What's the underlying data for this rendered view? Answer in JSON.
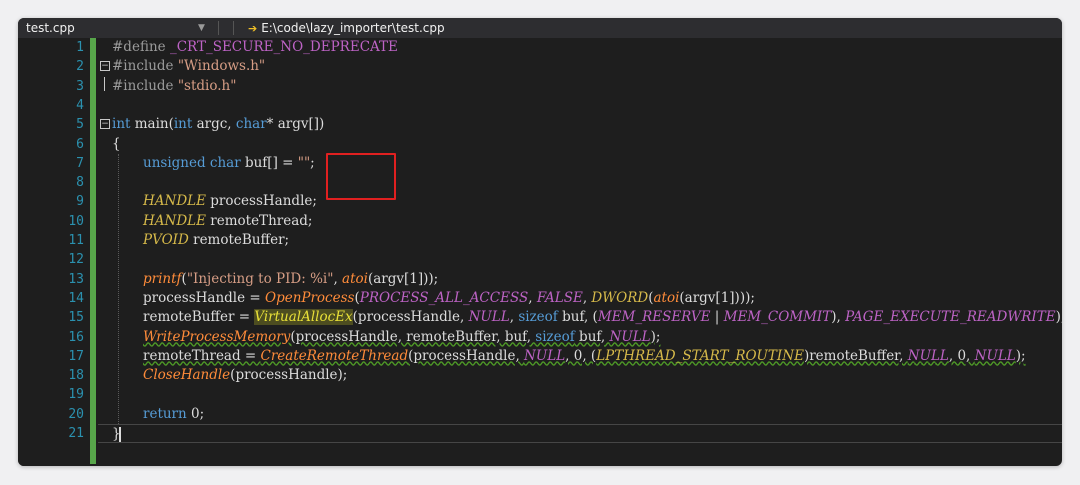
{
  "tab": {
    "filename": "test.cpp",
    "path": "E:\\code\\lazy_importer\\test.cpp",
    "dropdown_icon": "chevron-down-icon",
    "nav_icon": "arrow-right-icon"
  },
  "colors": {
    "keyword": "#569cd6",
    "preprocessor": "#9b9b9b",
    "macro": "#bd63c5",
    "string": "#d69d85",
    "type": "#d7ba4a",
    "function": "#dcdcaa",
    "line_number": "#2b91af",
    "change_bar": "#57a64a",
    "highlight_box": "#e02020"
  },
  "line_numbers": [
    "1",
    "2",
    "3",
    "4",
    "5",
    "6",
    "7",
    "8",
    "9",
    "10",
    "11",
    "12",
    "13",
    "14",
    "15",
    "16",
    "17",
    "18",
    "19",
    "20",
    "21"
  ],
  "code": {
    "l1": [
      "#define ",
      "_CRT_SECURE_NO_DEPRECATE"
    ],
    "l2": [
      "#include ",
      "\"Windows.h\""
    ],
    "l3": [
      "#include ",
      "\"stdio.h\""
    ],
    "l5": [
      "int",
      " main(",
      "int",
      " argc, ",
      "char",
      "* argv[])"
    ],
    "l6": [
      "{"
    ],
    "l7": [
      "unsigned",
      " ",
      "char",
      " buf[] = ",
      "\"\"",
      ";"
    ],
    "l9": [
      "HANDLE",
      " processHandle;"
    ],
    "l10": [
      "HANDLE",
      " remoteThread;"
    ],
    "l11": [
      "PVOID",
      " remoteBuffer;"
    ],
    "l13": [
      "printf",
      "(",
      "\"Injecting to PID: %i\"",
      ", ",
      "atoi",
      "(argv[1]));"
    ],
    "l14": [
      "processHandle = ",
      "OpenProcess",
      "(",
      "PROCESS_ALL_ACCESS",
      ", ",
      "FALSE",
      ", ",
      "DWORD",
      "(",
      "atoi",
      "(argv[1])));"
    ],
    "l15": [
      "remoteBuffer = ",
      "VirtualAllocEx",
      "(processHandle, ",
      "NULL",
      ", ",
      "sizeof",
      " buf, (",
      "MEM_RESERVE",
      " | ",
      "MEM_COMMIT",
      "), ",
      "PAGE_EXECUTE_READWRITE",
      ");"
    ],
    "l16": [
      "WriteProcessMemory",
      "(processHandle, remoteBuffer, buf, ",
      "sizeof",
      " buf, ",
      "NULL",
      ");"
    ],
    "l17": [
      "remoteThread = ",
      "CreateRemoteThread",
      "(processHandle, ",
      "NULL",
      ", 0, (",
      "LPTHREAD_START_ROUTINE",
      ")remoteBuffer, ",
      "NULL",
      ", 0, ",
      "NULL",
      ");"
    ],
    "l18": [
      "CloseHandle",
      "(processHandle);"
    ],
    "l20": [
      "return",
      " 0;"
    ],
    "l21": [
      "}"
    ]
  }
}
